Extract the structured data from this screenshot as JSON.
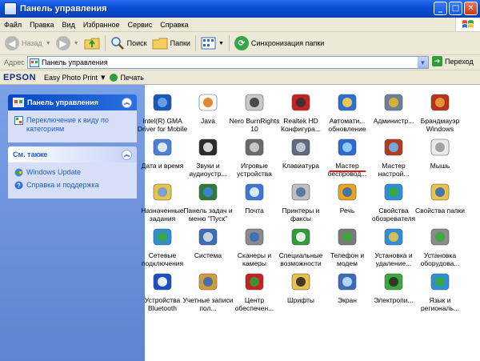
{
  "window": {
    "title": "Панель управления"
  },
  "menu": [
    "Файл",
    "Правка",
    "Вид",
    "Избранное",
    "Сервис",
    "Справка"
  ],
  "toolbar": {
    "back": "Назад",
    "search": "Поиск",
    "folders": "Папки",
    "sync": "Синхронизация папки"
  },
  "address": {
    "label": "Адрес",
    "value": "Панель управления",
    "go": "Переход"
  },
  "epson": {
    "logo": "EPSON",
    "app": "Easy Photo Print",
    "print": "Печать"
  },
  "left": {
    "panel1": {
      "title": "Панель управления",
      "link": "Переключение к виду по категориям"
    },
    "panel2": {
      "title": "См. также",
      "links": [
        "Windows Update",
        "Справка и поддержка"
      ]
    }
  },
  "items": [
    {
      "label": "Intel(R) GMA Driver for Mobile",
      "icon": "intel-gma-icon"
    },
    {
      "label": "Java",
      "icon": "java-icon"
    },
    {
      "label": "Nero BurnRights 10",
      "icon": "nero-icon"
    },
    {
      "label": "Realtek HD Конфигура...",
      "icon": "realtek-icon"
    },
    {
      "label": "Автомати... обновление",
      "icon": "auto-update-icon"
    },
    {
      "label": "Администр...",
      "icon": "admin-tools-icon"
    },
    {
      "label": "Брандмауэр Windows",
      "icon": "firewall-icon"
    },
    {
      "label": "Дата и время",
      "icon": "date-time-icon"
    },
    {
      "label": "Звуки и аудиоустр...",
      "icon": "sounds-icon"
    },
    {
      "label": "Игровые устройства",
      "icon": "game-controllers-icon"
    },
    {
      "label": "Клавиатура",
      "icon": "keyboard-icon"
    },
    {
      "label": "Мастер беспровод...",
      "icon": "wireless-wizard-icon"
    },
    {
      "label": "Мастер настрой...",
      "icon": "network-wizard-icon"
    },
    {
      "label": "Мышь",
      "icon": "mouse-icon"
    },
    {
      "label": "Назначенные задания",
      "icon": "scheduled-tasks-icon"
    },
    {
      "label": "Панель задач и меню \"Пуск\"",
      "icon": "taskbar-icon"
    },
    {
      "label": "Почта",
      "icon": "mail-icon"
    },
    {
      "label": "Принтеры и факсы",
      "icon": "printers-icon"
    },
    {
      "label": "Речь",
      "icon": "speech-icon"
    },
    {
      "label": "Свойства обозревателя",
      "icon": "internet-options-icon"
    },
    {
      "label": "Свойства папки",
      "icon": "folder-options-icon"
    },
    {
      "label": "Сетевые подключения",
      "icon": "network-connections-icon"
    },
    {
      "label": "Система",
      "icon": "system-icon"
    },
    {
      "label": "Сканеры и камеры",
      "icon": "scanners-icon"
    },
    {
      "label": "Специальные возможности",
      "icon": "accessibility-icon"
    },
    {
      "label": "Телефон и модем",
      "icon": "phone-modem-icon"
    },
    {
      "label": "Установка и удаление...",
      "icon": "add-remove-icon"
    },
    {
      "label": "Установка оборудова...",
      "icon": "add-hardware-icon"
    },
    {
      "label": "Устройства Bluetooth",
      "icon": "bluetooth-icon"
    },
    {
      "label": "Учетные записи пол...",
      "icon": "user-accounts-icon"
    },
    {
      "label": "Центр обеспечен...",
      "icon": "security-center-icon"
    },
    {
      "label": "Шрифты",
      "icon": "fonts-icon"
    },
    {
      "label": "Экран",
      "icon": "display-icon"
    },
    {
      "label": "Электропи...",
      "icon": "power-options-icon"
    },
    {
      "label": "Язык и региональ...",
      "icon": "regional-icon"
    }
  ]
}
